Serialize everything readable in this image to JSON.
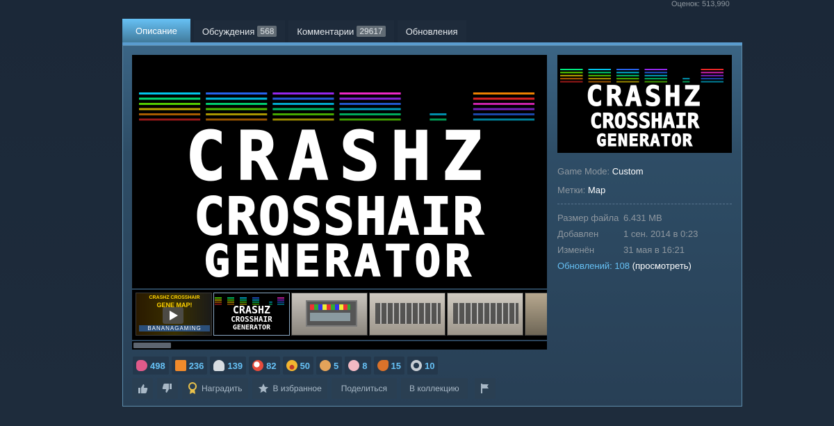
{
  "header": {
    "ratings_label": "Оценок: 513,990"
  },
  "tabs": [
    {
      "label": "Описание",
      "count": null,
      "active": true
    },
    {
      "label": "Обсуждения",
      "count": "568",
      "active": false
    },
    {
      "label": "Комментарии",
      "count": "29617",
      "active": false
    },
    {
      "label": "Обновления",
      "count": null,
      "active": false
    }
  ],
  "main_image": {
    "line1": "CRASHZ",
    "line2": "CROSSHAIR",
    "line3": "GENERATOR"
  },
  "thumbnail_1": {
    "caption_top": "CRASHZ CROSSHAIR",
    "caption_mid": "GENE  MAP!",
    "caption_bottom": "BANANAGAMING"
  },
  "details": {
    "game_mode_label": "Game Mode:",
    "game_mode_value": "Custom",
    "tags_label": "Метки:",
    "tags_value": "Map"
  },
  "stats": [
    {
      "key": "Размер файла",
      "value": "6.431 MB"
    },
    {
      "key": "Добавлен",
      "value": "1 сен. 2014 в 0:23"
    },
    {
      "key": "Изменён",
      "value": "31 мая в 16:21"
    }
  ],
  "updates": {
    "label": "Обновлений: 108",
    "view": "(просмотреть)"
  },
  "awards": [
    {
      "icon": "award-fish-icon",
      "count": "498",
      "color": "#e05a8a"
    },
    {
      "icon": "award-gift-icon",
      "count": "236",
      "color": "#f08a2b"
    },
    {
      "icon": "award-ghost-icon",
      "count": "139",
      "color": "#d8dde2"
    },
    {
      "icon": "award-chicken-icon",
      "count": "82",
      "color": "#e64b3c"
    },
    {
      "icon": "award-laugh-icon",
      "count": "50",
      "color": "#f2b530"
    },
    {
      "icon": "award-cookie-icon",
      "count": "5",
      "color": "#e3a35a"
    },
    {
      "icon": "award-brain-icon",
      "count": "8",
      "color": "#f2b9c3"
    },
    {
      "icon": "award-squirrel-icon",
      "count": "15",
      "color": "#d9722a"
    },
    {
      "icon": "award-headphones-icon",
      "count": "10",
      "color": "#c8ced4"
    }
  ],
  "actions": {
    "award_label": "Наградить",
    "favorite_label": "В избранное",
    "share_label": "Поделиться",
    "collection_label": "В коллекцию"
  }
}
